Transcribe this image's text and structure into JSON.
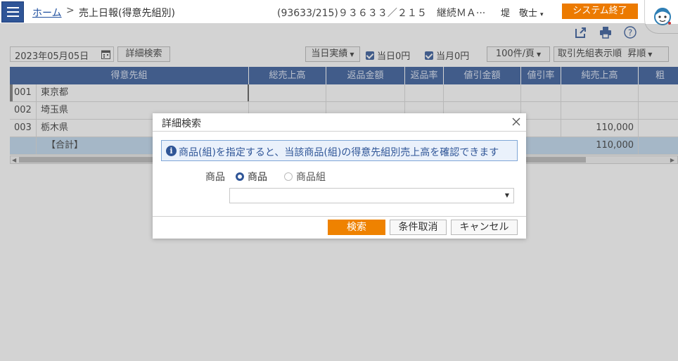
{
  "header": {
    "home_label": "ホーム",
    "separator": ">",
    "current_page": "売上日報(得意先組別)",
    "account_info": "(93633/215)９３６３３／２１５　継続ＭＡ···",
    "user_name": "堤　敬士",
    "user_caret": "▾",
    "system_end_label": "システム終了"
  },
  "filters": {
    "date_value": "2023年05月05日",
    "detail_search_label": "詳細検索",
    "actual_dropdown_label": "当日実績",
    "check_today_zero_label": "当日0円",
    "check_month_zero_label": "当月0円",
    "page_size_label": "100件/頁",
    "sort_key_label": "取引先組表示順",
    "sort_order_label": "昇順"
  },
  "table": {
    "columns": [
      "得意先組",
      "総売上高",
      "返品金額",
      "返品率",
      "値引金額",
      "値引率",
      "純売上高",
      "粗"
    ],
    "rows": [
      {
        "code": "001",
        "name": "東京都",
        "net_sales": ""
      },
      {
        "code": "002",
        "name": "埼玉県",
        "net_sales": ""
      },
      {
        "code": "003",
        "name": "栃木県",
        "net_sales": "110,000"
      }
    ],
    "total": {
      "label": "【合計】",
      "net_sales": "110,000"
    }
  },
  "dialog": {
    "title": "詳細検索",
    "info_text": "商品(組)を指定すると、当該商品(組)の得意先組別売上高を確認できます",
    "product_label": "商品",
    "option_product": "商品",
    "option_product_group": "商品組",
    "selected_option": "商品",
    "select_value": "",
    "search_button": "検索",
    "clear_button": "条件取消",
    "cancel_button": "キャンセル"
  },
  "colors": {
    "header_blue": "#2f5597",
    "accent_orange": "#ec7a00",
    "total_row": "#bdd7ee"
  }
}
